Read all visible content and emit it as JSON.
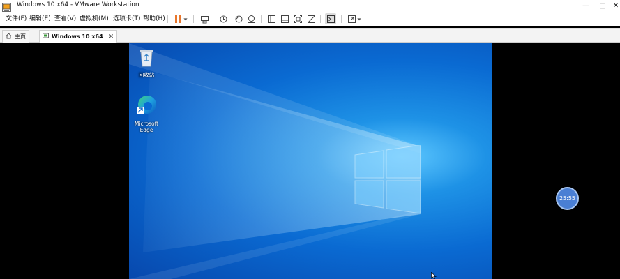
{
  "window": {
    "title": "Windows 10 x64 - VMware Workstation",
    "controls": [
      "—",
      "□",
      "✕"
    ]
  },
  "menu": {
    "items": [
      "文件(F)",
      "编辑(E)",
      "查看(V)",
      "虚拟机(M)",
      "选项卡(T)",
      "帮助(H)"
    ]
  },
  "toolbar": {
    "pause_color": "#e8762b",
    "icons": [
      "pause-icon",
      "dropdown-icon",
      "send-keys-icon",
      "snapshot-icon",
      "revert-snapshot-icon",
      "snapshot-manager-icon",
      "sidebar-icon",
      "thumbnail-icon",
      "fullscreen-icon",
      "unity-icon",
      "console-icon",
      "stretch-icon",
      "stretch-dropdown-icon"
    ]
  },
  "tabs": [
    {
      "label": "主页",
      "icon": "home-icon",
      "active": false
    },
    {
      "label": "Windows 10 x64",
      "icon": "vm-icon",
      "active": true,
      "close": "✕"
    }
  ],
  "desktop": {
    "icons": [
      {
        "label": "回收站",
        "icon": "recycle-bin-icon"
      },
      {
        "label": "Microsoft Edge",
        "icon": "edge-icon"
      }
    ]
  },
  "overlay": {
    "timer": "25:55"
  }
}
